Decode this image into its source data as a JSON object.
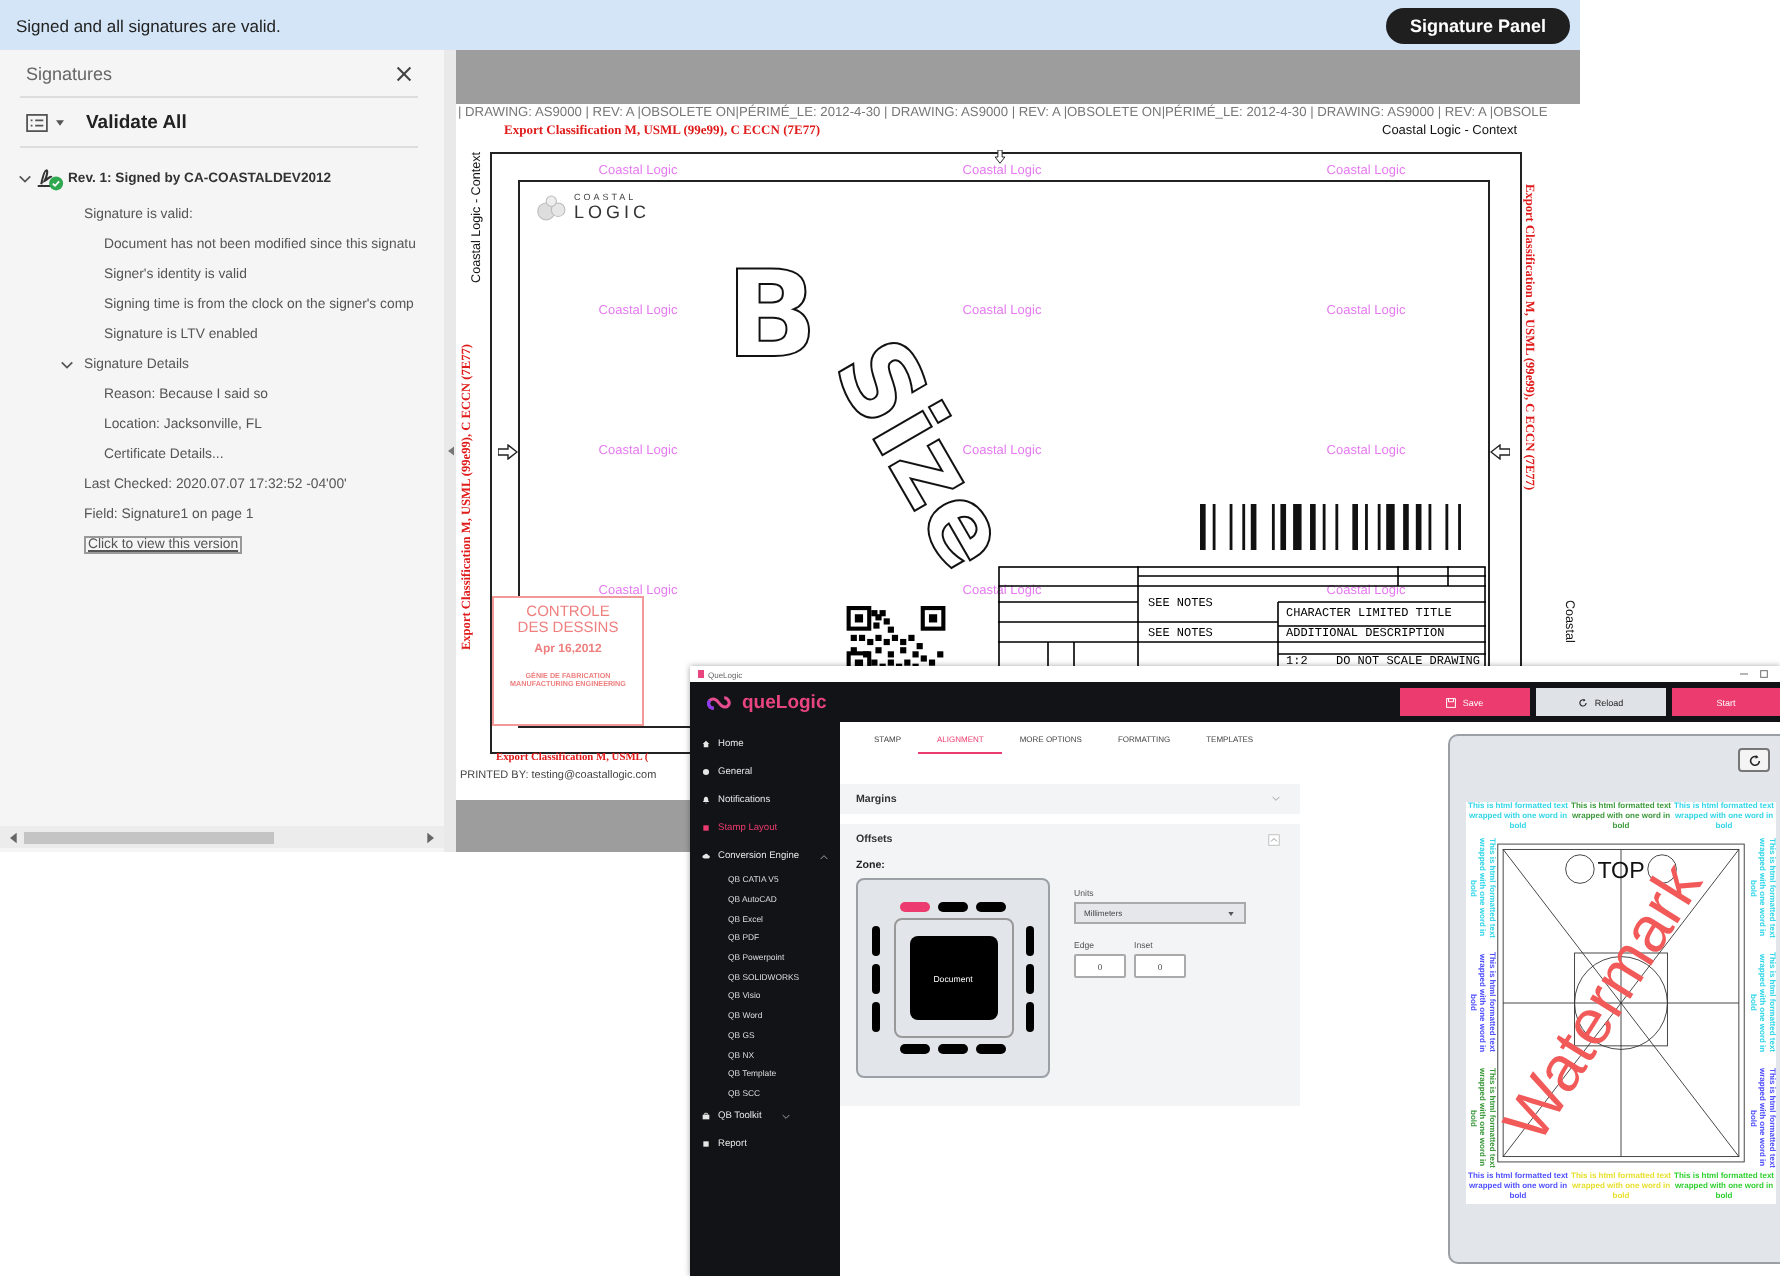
{
  "pdf_viewer": {
    "banner": {
      "message": "Signed and all signatures are valid.",
      "button": "Signature Panel"
    },
    "signatures_panel": {
      "title": "Signatures",
      "validate_all": "Validate All",
      "signature": {
        "label": "Rev. 1: Signed by CA-COASTALDEV2012",
        "expanded": true,
        "status": "Signature is valid:",
        "checks": [
          "Document has not been modified since this signatu",
          "Signer's identity is valid",
          "Signing time is from the clock on the signer's comp",
          "Signature is LTV enabled"
        ],
        "details": {
          "label": "Signature Details",
          "expanded": true,
          "items": [
            "Reason: Because I said so",
            "Location: Jacksonville, FL",
            "Certificate Details..."
          ]
        },
        "last_checked": "Last Checked: 2020.07.07 17:32:52 -04'00'",
        "field": "Field: Signature1 on page 1",
        "view_link": "Click to view this version"
      }
    },
    "drawing": {
      "header_strip": "| DRAWING: AS9000 | REV: A |OBSOLETE ON|PÉRIMÉ_LE: 2012-4-30 | DRAWING: AS9000 | REV: A |OBSOLETE ON|PÉRIMÉ_LE: 2012-4-30 | DRAWING: AS9000 | REV: A |OBSOLE",
      "export_top": "Export Classification M, USML (99e99), C ECCN (7E77)",
      "context_label": "Coastal Logic - Context",
      "side_context": "Coastal Logic - Context",
      "side_export_left": "Export Classification M, USML (99e99), C ECCN (7E77)",
      "side_export_right": "Export Classification M, USML (99e99), C ECCN (7E77)",
      "side_right_label": "Coastal",
      "watermarks": [
        "Coastal Logic",
        "Coastal Logic",
        "Coastal Logic",
        "Coastal Logic",
        "Coastal Logic",
        "Coastal Logic",
        "Coastal Logic",
        "Coastal Logic",
        "Coastal Logic",
        "Coastal Logic",
        "Coastal Logic",
        "Coastal Logic"
      ],
      "logo": {
        "top": "COASTAL",
        "bottom": "LOGIC"
      },
      "size_text": [
        "B",
        "Size"
      ],
      "title_block": {
        "notes": [
          "SEE NOTES",
          "SEE NOTES"
        ],
        "title": "CHARACTER LIMITED TITLE",
        "description": "ADDITIONAL DESCRIPTION",
        "scale": "1:2",
        "warning": "DO NOT SCALE DRAWING"
      },
      "stamp": {
        "lines": [
          "CONTROLE",
          "DES DESSINS"
        ],
        "date": "Apr 16,2012",
        "departments": [
          "GÉNIE DE FABRICATION",
          "MANUFACTURING ENGINEERING"
        ]
      },
      "export_bottom": "Export Classification M, USML (",
      "printed_by": "PRINTED BY: testing@coastallogic.com"
    }
  },
  "app": {
    "window_title": "QueLogic",
    "brand": "queLogic",
    "buttons": [
      {
        "label": "Save",
        "kind": "primary"
      },
      {
        "label": "Reload",
        "kind": "secondary"
      },
      {
        "label": "Start",
        "kind": "primary"
      }
    ],
    "nav": [
      {
        "label": "Home",
        "selected": false
      },
      {
        "label": "General",
        "selected": false
      },
      {
        "label": "Notifications",
        "selected": false
      },
      {
        "label": "Stamp Layout",
        "selected": true
      },
      {
        "label": "Conversion Engine",
        "selected": false,
        "expanded": true,
        "children": [
          "QB CATIA V5",
          "QB AutoCAD",
          "QB Excel",
          "QB PDF",
          "QB Powerpoint",
          "QB SOLIDWORKS",
          "QB Visio",
          "QB Word",
          "QB GS",
          "QB NX",
          "QB Template",
          "QB SCC"
        ]
      },
      {
        "label": "QB Toolkit",
        "selected": false,
        "expanded": false
      },
      {
        "label": "Report",
        "selected": false
      }
    ],
    "tabs": [
      {
        "label": "STAMP",
        "selected": false
      },
      {
        "label": "ALIGNMENT",
        "selected": true
      },
      {
        "label": "MORE OPTIONS",
        "selected": false
      },
      {
        "label": "FORMATTING",
        "selected": false
      },
      {
        "label": "TEMPLATES",
        "selected": false
      }
    ],
    "margins": {
      "title": "Margins",
      "expanded": false
    },
    "offsets": {
      "title": "Offsets",
      "expanded": true,
      "zone_label": "Zone:",
      "zone": {
        "top": [
          {
            "selected": true
          },
          {
            "selected": false
          },
          {
            "selected": false
          }
        ],
        "left": [
          {
            "selected": false
          },
          {
            "selected": false
          },
          {
            "selected": false
          }
        ],
        "right": [
          {
            "selected": false
          },
          {
            "selected": false
          },
          {
            "selected": false
          }
        ],
        "bottom": [
          {
            "selected": false
          },
          {
            "selected": false
          },
          {
            "selected": false
          }
        ],
        "center_label": "Document"
      },
      "units_label": "Units",
      "units_value": "Millimeters",
      "edge_label": "Edge",
      "edge_value": "0",
      "inset_label": "Inset",
      "inset_value": "0"
    },
    "preview": {
      "top_label": "TOP",
      "watermark": "Watermark",
      "margin_texts": {
        "top": [
          {
            "text": "This is html formatted text wrapped with one word in bold",
            "color": "#33d6e8"
          },
          {
            "text": "This is html formatted text wrapped with one word in bold",
            "color": "#3c9a3c"
          },
          {
            "text": "This is html formatted text wrapped with one word in bold",
            "color": "#33d6e8"
          }
        ],
        "right": [
          {
            "text": "This is html formatted text wrapped with one word in bold",
            "color": "#33d6e8"
          },
          {
            "text": "This is html formatted text wrapped with one word in bold",
            "color": "#33d6e8"
          },
          {
            "text": "This is html formatted text wrapped with one word in bold",
            "color": "#5050ff"
          }
        ],
        "bottom": [
          {
            "text": "This is html formatted text wrapped with one word in bold",
            "color": "#5050ff"
          },
          {
            "text": "This is html formatted text wrapped with one word in bold",
            "color": "#e8e030"
          },
          {
            "text": "This is html formatted text wrapped with one word in bold",
            "color": "#30d030"
          }
        ],
        "left": [
          {
            "text": "This is html formatted text wrapped with one word in bold",
            "color": "#33d6e8"
          },
          {
            "text": "This is html formatted text wrapped with one word in bold",
            "color": "#5050ff"
          },
          {
            "text": "This is html formatted text wrapped with one word in bold",
            "color": "#3c9a3c"
          }
        ]
      }
    }
  }
}
